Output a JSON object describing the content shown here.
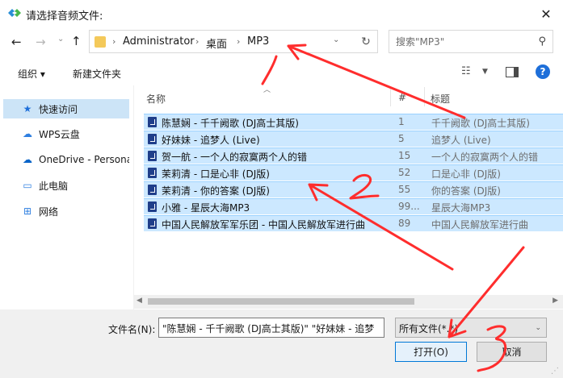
{
  "window": {
    "title": "请选择音频文件:"
  },
  "nav": {
    "breadcrumb": [
      "Administrator",
      "桌面",
      "MP3"
    ],
    "search_placeholder": "搜索\"MP3\""
  },
  "toolbar": {
    "organize": "组织 ▾",
    "new_folder": "新建文件夹"
  },
  "sidebar": {
    "items": [
      {
        "label": "快速访问",
        "icon": "star-icon"
      },
      {
        "label": "WPS云盘",
        "icon": "cloud-icon"
      },
      {
        "label": "OneDrive - Personal",
        "icon": "onedrive-icon"
      },
      {
        "label": "此电脑",
        "icon": "computer-icon"
      },
      {
        "label": "网络",
        "icon": "network-icon"
      }
    ]
  },
  "list": {
    "headers": {
      "name": "名称",
      "number": "#",
      "title": "标题"
    },
    "rows": [
      {
        "name": "陈慧娴 - 千千阙歌 (DJ高士其版)",
        "number": "1",
        "title": "千千阙歌 (DJ高士其版)"
      },
      {
        "name": "好妹妹 - 追梦人 (Live)",
        "number": "5",
        "title": "追梦人 (Live)"
      },
      {
        "name": "贺一航 - 一个人的寂寞两个人的错",
        "number": "15",
        "title": "一个人的寂寞两个人的错"
      },
      {
        "name": "茉莉清 - 口是心非 (DJ版)",
        "number": "52",
        "title": "口是心非 (DJ版)"
      },
      {
        "name": "茉莉清 - 你的答案 (DJ版)",
        "number": "55",
        "title": "你的答案 (DJ版)"
      },
      {
        "name": "小雅 - 星辰大海MP3",
        "number": "99...",
        "title": "星辰大海MP3"
      },
      {
        "name": "中国人民解放军军乐团 - 中国人民解放军进行曲",
        "number": "89",
        "title": "中国人民解放军进行曲"
      }
    ]
  },
  "footer": {
    "filename_label": "文件名(N):",
    "filename_value": "\"陈慧娴 - 千千阙歌 (DJ高士其版)\" \"好妹妹 - 追梦",
    "filetype": "所有文件(*.*)",
    "open": "打开(O)",
    "cancel": "取消"
  },
  "annotations": [
    "1",
    "2",
    "3"
  ],
  "colors": {
    "selection": "#cce8ff",
    "accent": "#0078d7",
    "annotation": "#ff2d2d"
  }
}
